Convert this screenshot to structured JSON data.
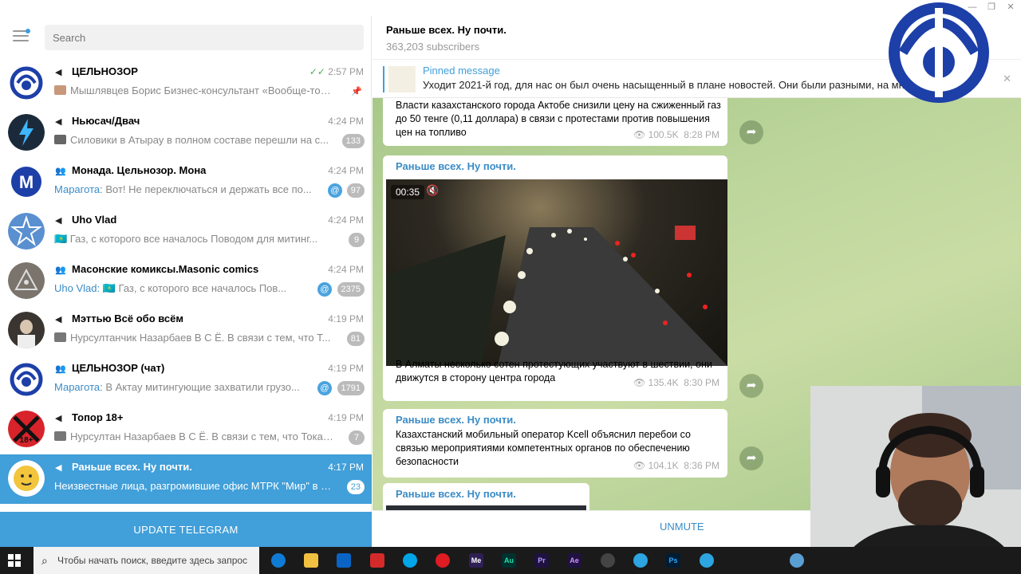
{
  "window": {
    "minimize": "—",
    "restore": "❐",
    "close": "✕"
  },
  "search": {
    "placeholder": "Search"
  },
  "chats": [
    {
      "title": "ЦЕЛЬНОЗОР",
      "type": "channel",
      "time": "2:57 PM",
      "read": "✓✓",
      "preview": "Мышлявцев Борис Бизнес-консультант «Вообще-то, ...",
      "pinned": true
    },
    {
      "title": "Ньюсач/Двач",
      "type": "channel",
      "time": "4:24 PM",
      "preview": "Силовики в Атырау в полном составе перешли на с...",
      "badge": "133"
    },
    {
      "title": "Монада. Цельнозор. Мона",
      "type": "group",
      "time": "4:24 PM",
      "sender": "Марагота:",
      "preview": " Вот! Не переключаться и держать все по...",
      "at": "@",
      "badge": "97"
    },
    {
      "title": "Uho Vlad",
      "type": "channel",
      "time": "4:24 PM",
      "preview": "🇰🇿 Газ, с которого все началось  Поводом для митинг...",
      "badge": "9"
    },
    {
      "title": "Масонские комиксы.Masonic comics",
      "type": "group",
      "time": "4:24 PM",
      "sender": "Uho Vlad:",
      "preview": " 🇰🇿 Газ, с которого все началось  Пов...",
      "at": "@",
      "badge": "2375"
    },
    {
      "title": "Мэттью Всё обо всём",
      "type": "channel",
      "time": "4:19 PM",
      "preview": "Нурсултанчик Назарбаев В С Ё.   В связи с тем, что Т...",
      "badge": "81"
    },
    {
      "title": "ЦЕЛЬНОЗОР (чат)",
      "type": "group",
      "time": "4:19 PM",
      "sender": "Марагота:",
      "preview": " В Актау митингующие захватили грузо...",
      "at": "@",
      "badge": "1791"
    },
    {
      "title": "Топор 18+",
      "type": "channel",
      "time": "4:19 PM",
      "preview": "Нурсултан Назарбаев В С Ё.   В связи с тем, что Токае...",
      "badge": "7"
    },
    {
      "title": "Раньше всех. Ну почти.",
      "type": "channel",
      "time": "4:17 PM",
      "preview": "Неизвестные лица, разгромившие офис МТРК \"Мир\" в А...",
      "badge": "23",
      "active": true
    }
  ],
  "update_button": "UPDATE TELEGRAM",
  "channel": {
    "title": "Раньше всех. Ну почти.",
    "subscribers": "363,203 subscribers"
  },
  "pinned": {
    "label": "Pinned message",
    "text": "Уходит 2021-й год, для нас он был очень насыщенный в плане новостей. Они были разными, на много иногда с..."
  },
  "messages": [
    {
      "text": "Власти казахстанского города Актобе снизили цену на сжиженный газ до 50 тенге (0,11 доллара) в связи с протестами против повышения цен на топливо",
      "views": "100.5K",
      "time": "8:28 PM"
    },
    {
      "author": "Раньше всех. Ну почти.",
      "video_time": "00:35",
      "text": "В Алматы несколько сотен протестующих участвуют в шествии, они движутся в сторону центра города",
      "views": "135.4K",
      "time": "8:30 PM"
    },
    {
      "author": "Раньше всех. Ну почти.",
      "text": "Казахстанский мобильный оператор Kcell объяснил перебои со связью мероприятиями компетентных органов по обеспечению безопасности",
      "views": "104.1K",
      "time": "8:36 PM"
    },
    {
      "author": "Раньше всех. Ну почти."
    }
  ],
  "unmute_button": "UNMUTE",
  "taskbar": {
    "search_placeholder": "Чтобы начать поиск, введите здесь запрос",
    "apps": [
      "Edge",
      "Explorer",
      "Outlook",
      "Acrobat",
      "Skype",
      "Opera",
      "Me",
      "Au",
      "Pr",
      "Ae",
      "OBS",
      "Telegram",
      "Ps",
      "Telegram2"
    ],
    "app_labels": {
      "me": "Me",
      "au": "Au",
      "pr": "Pr",
      "ae": "Ae",
      "ps": "Ps"
    }
  },
  "colors": {
    "accent": "#419fd9",
    "chat_bg": "#b7d197",
    "taskbar": "#1a1a1a"
  }
}
